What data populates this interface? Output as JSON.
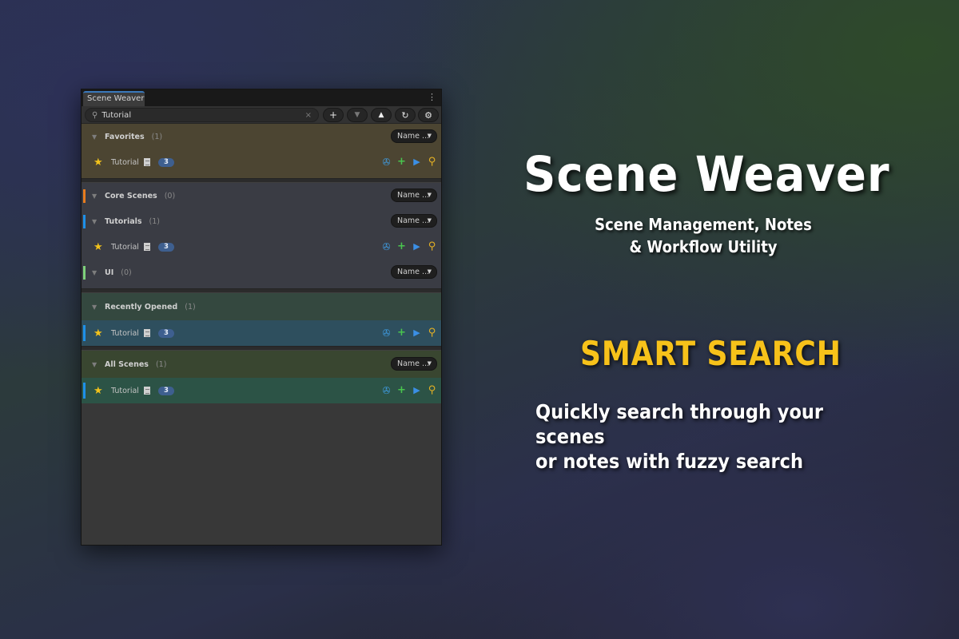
{
  "window": {
    "tab_title": "Scene Weaver",
    "search": {
      "value": "Tutorial",
      "placeholder": ""
    },
    "toolbar_icons": [
      "add-icon",
      "expand-all-icon",
      "collapse-all-icon",
      "refresh-icon",
      "settings-icon"
    ],
    "groups": [
      {
        "name": "Favorites",
        "count": "(1)",
        "sort_label": "Name ...",
        "bg": "#4c4532",
        "rows": [
          {
            "name": "Tutorial",
            "badge": "3"
          }
        ]
      },
      {
        "name": "Core Scenes",
        "count": "(0)",
        "sort_label": "Name ...",
        "bg": "#3a3c44",
        "color": "#e87c1e",
        "rows": []
      },
      {
        "name": "Tutorials",
        "count": "(1)",
        "sort_label": "Name ...",
        "bg": "#3a3c44",
        "color": "#1e90e8",
        "rows": [
          {
            "name": "Tutorial",
            "badge": "3"
          }
        ]
      },
      {
        "name": "UI",
        "count": "(0)",
        "sort_label": "Name ...",
        "bg": "#3a3c44",
        "color": "#7ed07a",
        "rows": []
      },
      {
        "name": "Recently Opened",
        "count": "(1)",
        "sort_label": "",
        "bg": "#34483f",
        "rows": [
          {
            "name": "Tutorial",
            "badge": "3",
            "selected": true
          }
        ]
      },
      {
        "name": "All Scenes",
        "count": "(1)",
        "sort_label": "Name ...",
        "bg": "#394630",
        "rows": [
          {
            "name": "Tutorial",
            "badge": "3",
            "selected": true
          }
        ]
      }
    ]
  },
  "promo": {
    "title": "Scene Weaver",
    "subtitle_line1": "Scene Management, Notes",
    "subtitle_line2": "& Workflow Utility",
    "heading": "SMART SEARCH",
    "desc_line1": "Quickly search through your scenes",
    "desc_line2": "or notes with fuzzy search"
  }
}
